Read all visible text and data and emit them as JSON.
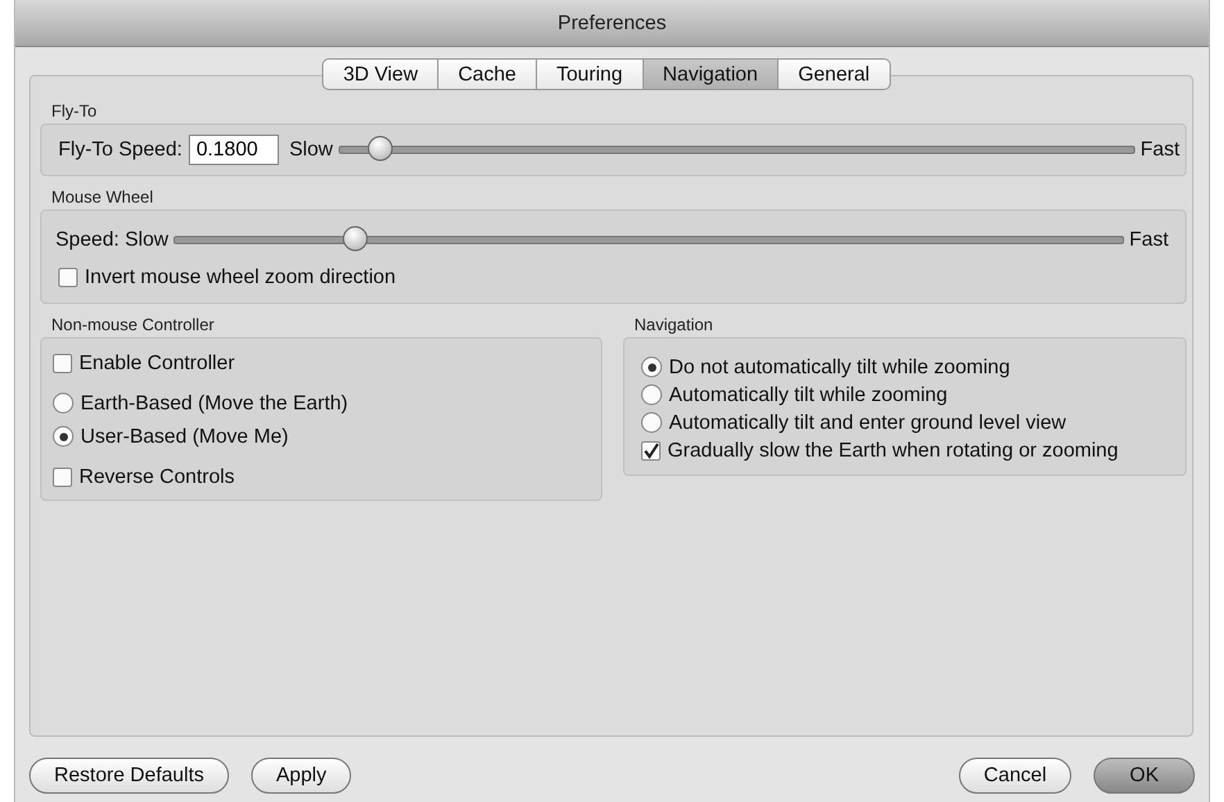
{
  "window": {
    "title": "Preferences"
  },
  "tabs": [
    {
      "label": "3D View",
      "selected": false
    },
    {
      "label": "Cache",
      "selected": false
    },
    {
      "label": "Touring",
      "selected": false
    },
    {
      "label": "Navigation",
      "selected": true
    },
    {
      "label": "General",
      "selected": false
    }
  ],
  "fly_to": {
    "title": "Fly-To",
    "speed_label": "Fly-To Speed:",
    "speed_value": "0.1800",
    "slow": "Slow",
    "fast": "Fast",
    "level": 0.05
  },
  "mouse_wheel": {
    "title": "Mouse Wheel",
    "speed_label": "Speed:",
    "slow": "Slow",
    "fast": "Fast",
    "level": 0.19,
    "invert": {
      "label": "Invert mouse wheel zoom direction",
      "checked": false
    }
  },
  "controller": {
    "title": "Non-mouse Controller",
    "items": [
      {
        "kind": "checkbox",
        "label": "Enable Controller",
        "checked": false
      },
      {
        "kind": "radio",
        "label": "Earth-Based (Move the Earth)",
        "selected": false
      },
      {
        "kind": "radio",
        "label": "User-Based (Move Me)",
        "selected": true
      },
      {
        "kind": "checkbox",
        "label": "Reverse Controls",
        "checked": false
      }
    ]
  },
  "navigation": {
    "title": "Navigation",
    "items": [
      {
        "kind": "radio",
        "label": "Do not automatically tilt while zooming",
        "selected": true
      },
      {
        "kind": "radio",
        "label": "Automatically tilt while zooming",
        "selected": false
      },
      {
        "kind": "radio",
        "label": "Automatically tilt and enter ground level view",
        "selected": false
      },
      {
        "kind": "checkbox",
        "label": "Gradually slow the Earth when rotating or zooming",
        "checked": true
      }
    ]
  },
  "buttons_left": [
    {
      "label": "Restore Defaults",
      "default": false
    },
    {
      "label": "Apply",
      "default": false
    }
  ],
  "buttons_right": [
    {
      "label": "Cancel",
      "default": false
    },
    {
      "label": "OK",
      "default": true
    }
  ]
}
